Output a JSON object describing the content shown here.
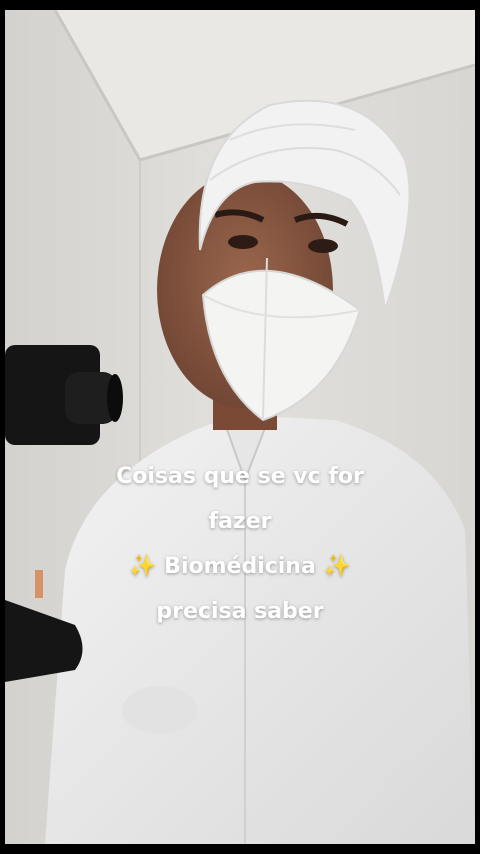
{
  "caption": {
    "line1": "Coisas que se vc for",
    "line2": "fazer",
    "sparkle": "✨",
    "line3": "Biomédicina",
    "line4": "precisa saber"
  },
  "colors": {
    "wall": "#dedcd8",
    "ceiling": "#e9e8e4",
    "gown": "#eeeeee",
    "skin": "#8a5a44",
    "microscope": "#1a1a1a",
    "sparkle": "#f4c430"
  },
  "icons": [
    "sparkle-icon",
    "sparkle-icon"
  ]
}
